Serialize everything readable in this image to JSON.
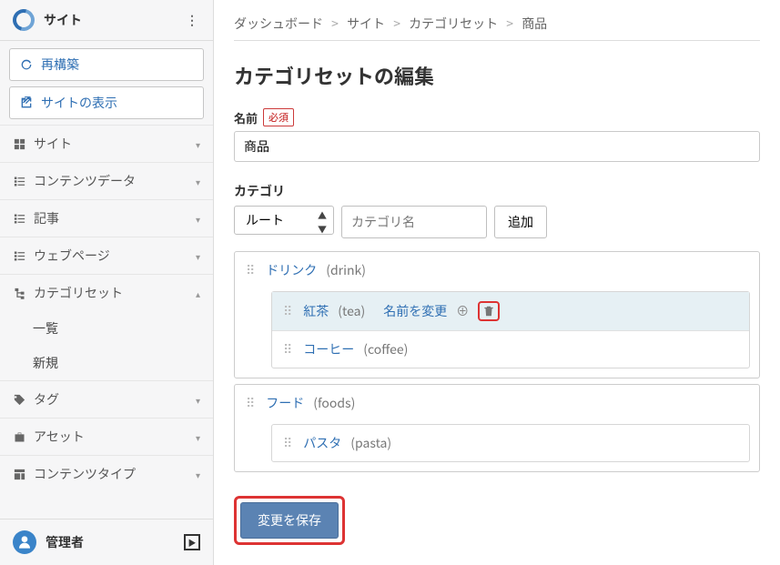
{
  "sidebar": {
    "title": "サイト",
    "rebuild": "再構築",
    "viewSite": "サイトの表示",
    "sections": [
      {
        "label": "サイト",
        "icon": "grid"
      },
      {
        "label": "コンテンツデータ",
        "icon": "items"
      },
      {
        "label": "記事",
        "icon": "items"
      },
      {
        "label": "ウェブページ",
        "icon": "items"
      },
      {
        "label": "カテゴリセット",
        "icon": "tree",
        "expanded": true,
        "subitems": [
          {
            "label": "一覧"
          },
          {
            "label": "新規"
          }
        ]
      },
      {
        "label": "タグ",
        "icon": "tag"
      },
      {
        "label": "アセット",
        "icon": "briefcase"
      },
      {
        "label": "コンテンツタイプ",
        "icon": "layout"
      }
    ],
    "user": "管理者"
  },
  "breadcrumb": {
    "items": [
      "ダッシュボード",
      "サイト",
      "カテゴリセット",
      "商品"
    ]
  },
  "page": {
    "title": "カテゴリセットの編集",
    "nameLabel": "名前",
    "required": "必須",
    "nameValue": "商品",
    "catLabel": "カテゴリ",
    "rootOption": "ルート",
    "catNamePlaceholder": "カテゴリ名",
    "addButton": "追加",
    "renameLabel": "名前を変更",
    "saveButton": "変更を保存",
    "categories": [
      {
        "name": "ドリンク",
        "slug": "drink",
        "children": [
          {
            "name": "紅茶",
            "slug": "tea",
            "selected": true
          },
          {
            "name": "コーヒー",
            "slug": "coffee"
          }
        ]
      },
      {
        "name": "フード",
        "slug": "foods",
        "children": [
          {
            "name": "パスタ",
            "slug": "pasta"
          }
        ]
      }
    ]
  }
}
